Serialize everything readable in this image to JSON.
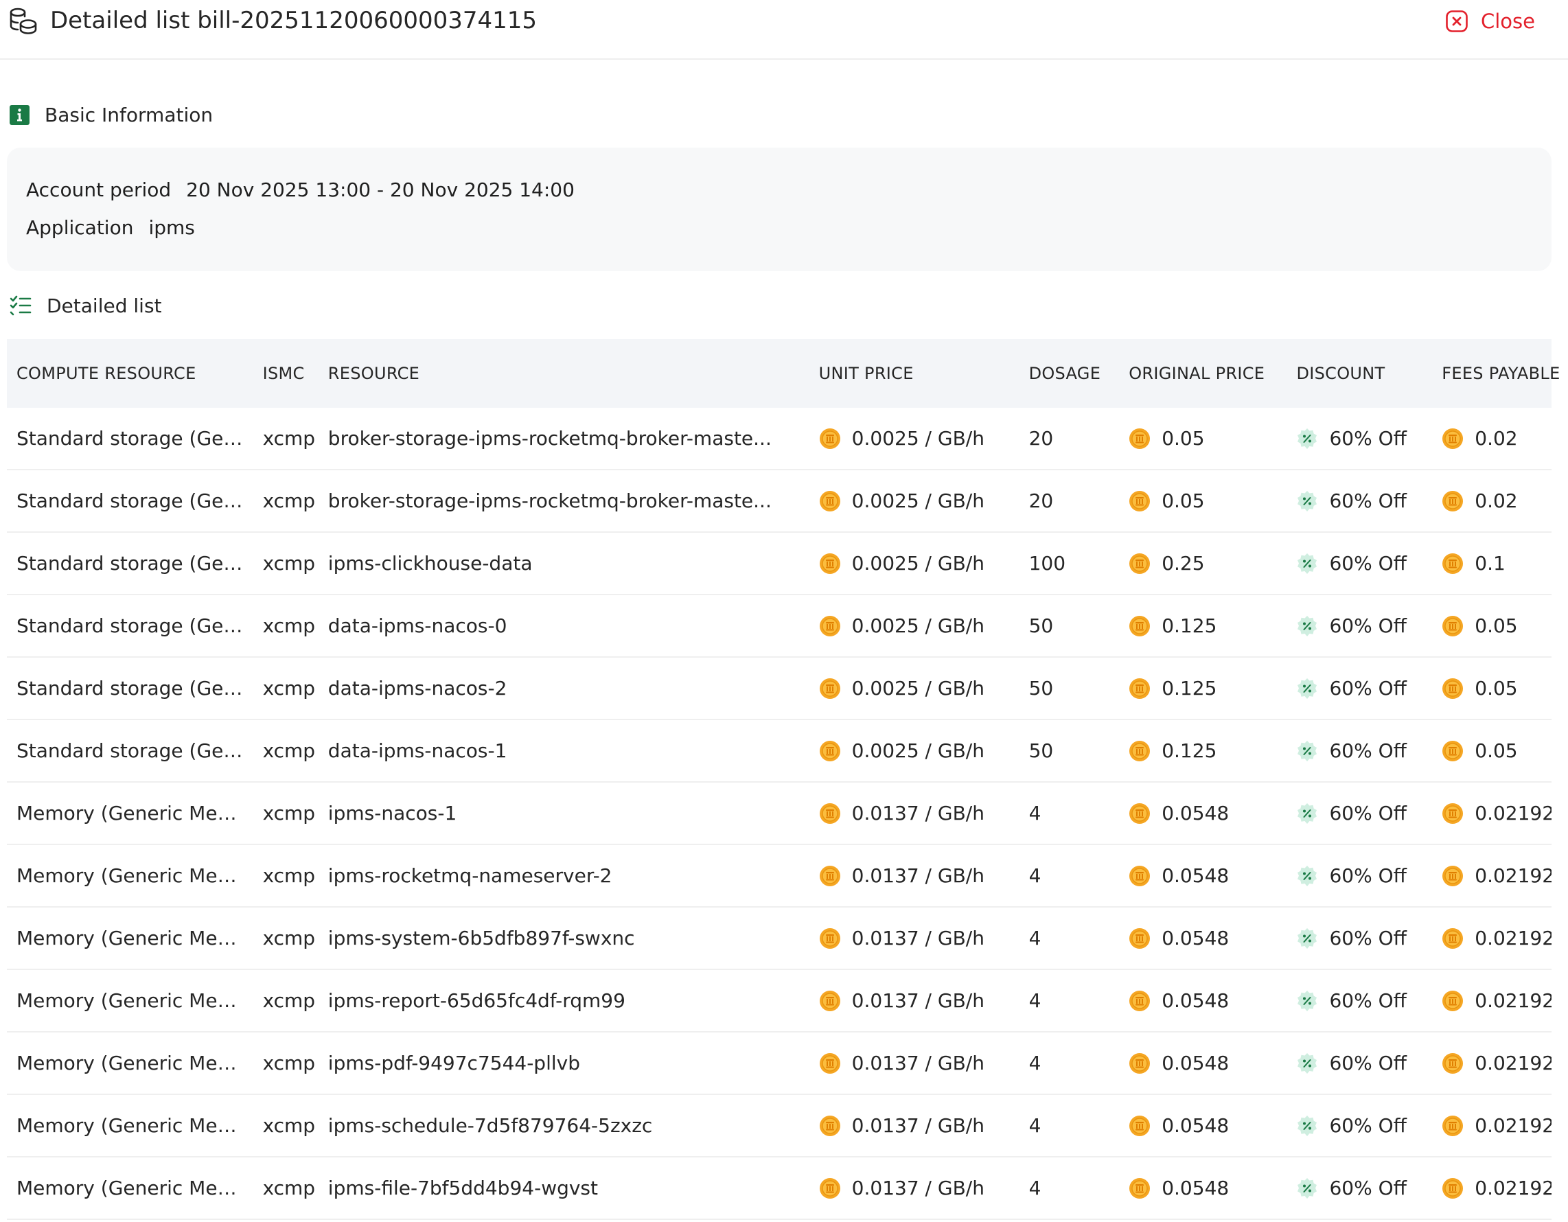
{
  "header": {
    "title": "Detailed list bill-20251120060000374115",
    "close_label": "Close",
    "icon": "coins-icon"
  },
  "basic_info": {
    "heading": "Basic Information",
    "account_period_label": "Account period",
    "account_period_value": "20 Nov 2025 13:00 - 20 Nov 2025 14:00",
    "application_label": "Application",
    "application_value": "ipms"
  },
  "detail": {
    "heading": "Detailed list",
    "columns": [
      "COMPUTE RESOURCE",
      "ISMC",
      "RESOURCE",
      "UNIT PRICE",
      "DOSAGE",
      "ORIGINAL PRICE",
      "DISCOUNT",
      "FEES PAYABLE"
    ],
    "rows": [
      {
        "compute": "Standard storage (Generic Storage)",
        "ismc": "xcmp",
        "resource": "broker-storage-ipms-rocketmq-broker-maste...",
        "unit_price": "0.0025 / GB/h",
        "dosage": "20",
        "original_price": "0.05",
        "discount": "60% Off",
        "fees": "0.02"
      },
      {
        "compute": "Standard storage (Generic Storage)",
        "ismc": "xcmp",
        "resource": "broker-storage-ipms-rocketmq-broker-maste...",
        "unit_price": "0.0025 / GB/h",
        "dosage": "20",
        "original_price": "0.05",
        "discount": "60% Off",
        "fees": "0.02"
      },
      {
        "compute": "Standard storage (Generic Storage)",
        "ismc": "xcmp",
        "resource": "ipms-clickhouse-data",
        "unit_price": "0.0025 / GB/h",
        "dosage": "100",
        "original_price": "0.25",
        "discount": "60% Off",
        "fees": "0.1"
      },
      {
        "compute": "Standard storage (Generic Storage)",
        "ismc": "xcmp",
        "resource": "data-ipms-nacos-0",
        "unit_price": "0.0025 / GB/h",
        "dosage": "50",
        "original_price": "0.125",
        "discount": "60% Off",
        "fees": "0.05"
      },
      {
        "compute": "Standard storage (Generic Storage)",
        "ismc": "xcmp",
        "resource": "data-ipms-nacos-2",
        "unit_price": "0.0025 / GB/h",
        "dosage": "50",
        "original_price": "0.125",
        "discount": "60% Off",
        "fees": "0.05"
      },
      {
        "compute": "Standard storage (Generic Storage)",
        "ismc": "xcmp",
        "resource": "data-ipms-nacos-1",
        "unit_price": "0.0025 / GB/h",
        "dosage": "50",
        "original_price": "0.125",
        "discount": "60% Off",
        "fees": "0.05"
      },
      {
        "compute": "Memory (Generic Memory)",
        "ismc": "xcmp",
        "resource": "ipms-nacos-1",
        "unit_price": "0.0137 / GB/h",
        "dosage": "4",
        "original_price": "0.0548",
        "discount": "60% Off",
        "fees": "0.02192"
      },
      {
        "compute": "Memory (Generic Memory)",
        "ismc": "xcmp",
        "resource": "ipms-rocketmq-nameserver-2",
        "unit_price": "0.0137 / GB/h",
        "dosage": "4",
        "original_price": "0.0548",
        "discount": "60% Off",
        "fees": "0.02192"
      },
      {
        "compute": "Memory (Generic Memory)",
        "ismc": "xcmp",
        "resource": "ipms-system-6b5dfb897f-swxnc",
        "unit_price": "0.0137 / GB/h",
        "dosage": "4",
        "original_price": "0.0548",
        "discount": "60% Off",
        "fees": "0.02192"
      },
      {
        "compute": "Memory (Generic Memory)",
        "ismc": "xcmp",
        "resource": "ipms-report-65d65fc4df-rqm99",
        "unit_price": "0.0137 / GB/h",
        "dosage": "4",
        "original_price": "0.0548",
        "discount": "60% Off",
        "fees": "0.02192"
      },
      {
        "compute": "Memory (Generic Memory)",
        "ismc": "xcmp",
        "resource": "ipms-pdf-9497c7544-pllvb",
        "unit_price": "0.0137 / GB/h",
        "dosage": "4",
        "original_price": "0.0548",
        "discount": "60% Off",
        "fees": "0.02192"
      },
      {
        "compute": "Memory (Generic Memory)",
        "ismc": "xcmp",
        "resource": "ipms-schedule-7d5f879764-5zxzc",
        "unit_price": "0.0137 / GB/h",
        "dosage": "4",
        "original_price": "0.0548",
        "discount": "60% Off",
        "fees": "0.02192"
      },
      {
        "compute": "Memory (Generic Memory)",
        "ismc": "xcmp",
        "resource": "ipms-file-7bf5dd4b94-wgvst",
        "unit_price": "0.0137 / GB/h",
        "dosage": "4",
        "original_price": "0.0548",
        "discount": "60% Off",
        "fees": "0.02192"
      }
    ]
  },
  "colors": {
    "close_red": "#e3202b",
    "info_green": "#1a7a45",
    "coin_gold": "#f5a623",
    "discount_green": "#cfeee0"
  }
}
